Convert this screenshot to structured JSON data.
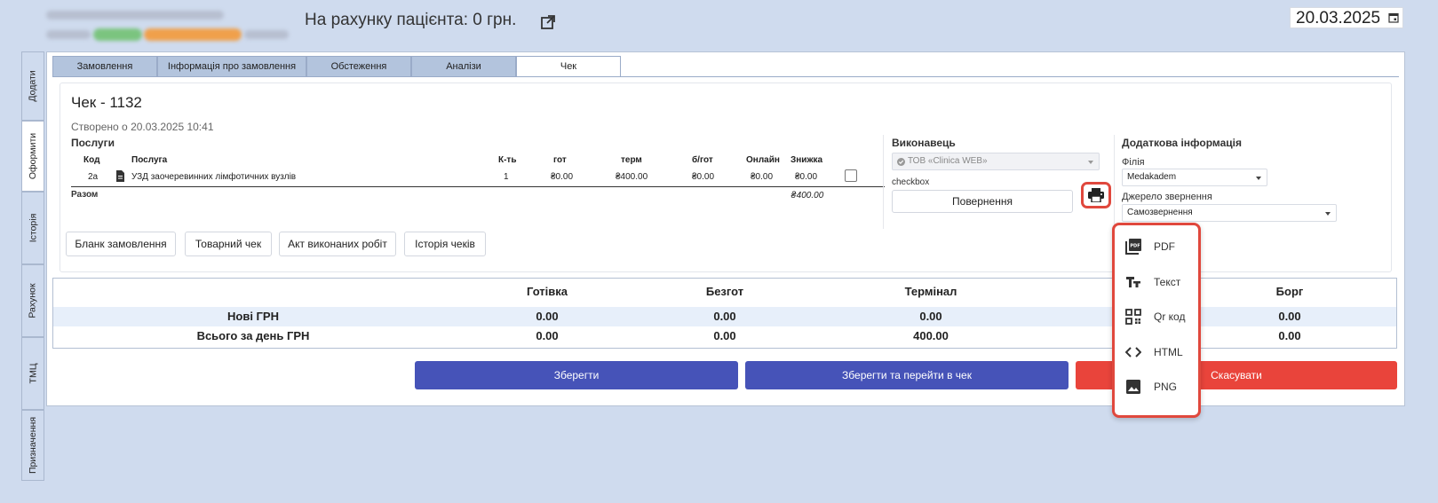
{
  "header": {
    "account_title": "На рахунку пацієнта: 0 грн.",
    "date": "20.03.2025"
  },
  "vertical_tabs": [
    "Додати",
    "Оформити",
    "Історія",
    "Рахунок",
    "ТМЦ",
    "Призначення"
  ],
  "tabs": [
    "Замовлення",
    "Інформація про замовлення",
    "Обстеження",
    "Аналізи",
    "Чек"
  ],
  "check": {
    "title": "Чек - 1132",
    "created": "Створено о 20.03.2025 10:41",
    "services_label": "Послуги",
    "columns": {
      "code": "Код",
      "service": "Послуга",
      "qty": "К-ть",
      "cash": "гот",
      "terminal": "терм",
      "noncash": "б/гот",
      "online": "Онлайн",
      "discount": "Знижка"
    },
    "row": {
      "code": "2а",
      "service": "УЗД заочеревинних лімфотичних вузлів",
      "qty": "1",
      "cash": "₴0.00",
      "terminal": "₴400.00",
      "noncash": "₴0.00",
      "online": "₴0.00",
      "discount": "₴0.00"
    },
    "total_label": "Разом",
    "total_value": "₴400.00"
  },
  "executor": {
    "label": "Виконавець",
    "value": "ТОВ «Clinica WEB»",
    "checkbox_label": "checkbox",
    "return_button": "Повернення"
  },
  "additional": {
    "label": "Додаткова інформація",
    "branch_label": "Філія",
    "branch_value": "Medakadem",
    "source_label": "Джерело звернення",
    "source_value": "Самозвернення"
  },
  "doc_buttons": [
    "Бланк замовлення",
    "Товарний чек",
    "Акт виконаних робіт",
    "Історія чеків"
  ],
  "totals": {
    "headers": [
      "Готівка",
      "Безгот",
      "Термінал",
      "Борг"
    ],
    "rows": [
      {
        "label": "Нові ГРН",
        "values": [
          "0.00",
          "0.00",
          "0.00",
          "0.00"
        ]
      },
      {
        "label": "Всього за день ГРН",
        "values": [
          "0.00",
          "0.00",
          "400.00",
          "0.00"
        ]
      }
    ]
  },
  "actions": {
    "save": "Зберегти",
    "save_and_go": "Зберегти та перейти в чек",
    "cancel": "Скасувати"
  },
  "print_menu": [
    "PDF",
    "Текст",
    "Qr код",
    "HTML",
    "PNG"
  ],
  "colors": {
    "primary": "#4653b8",
    "danger": "#e9443b",
    "highlight": "#e0483d"
  }
}
